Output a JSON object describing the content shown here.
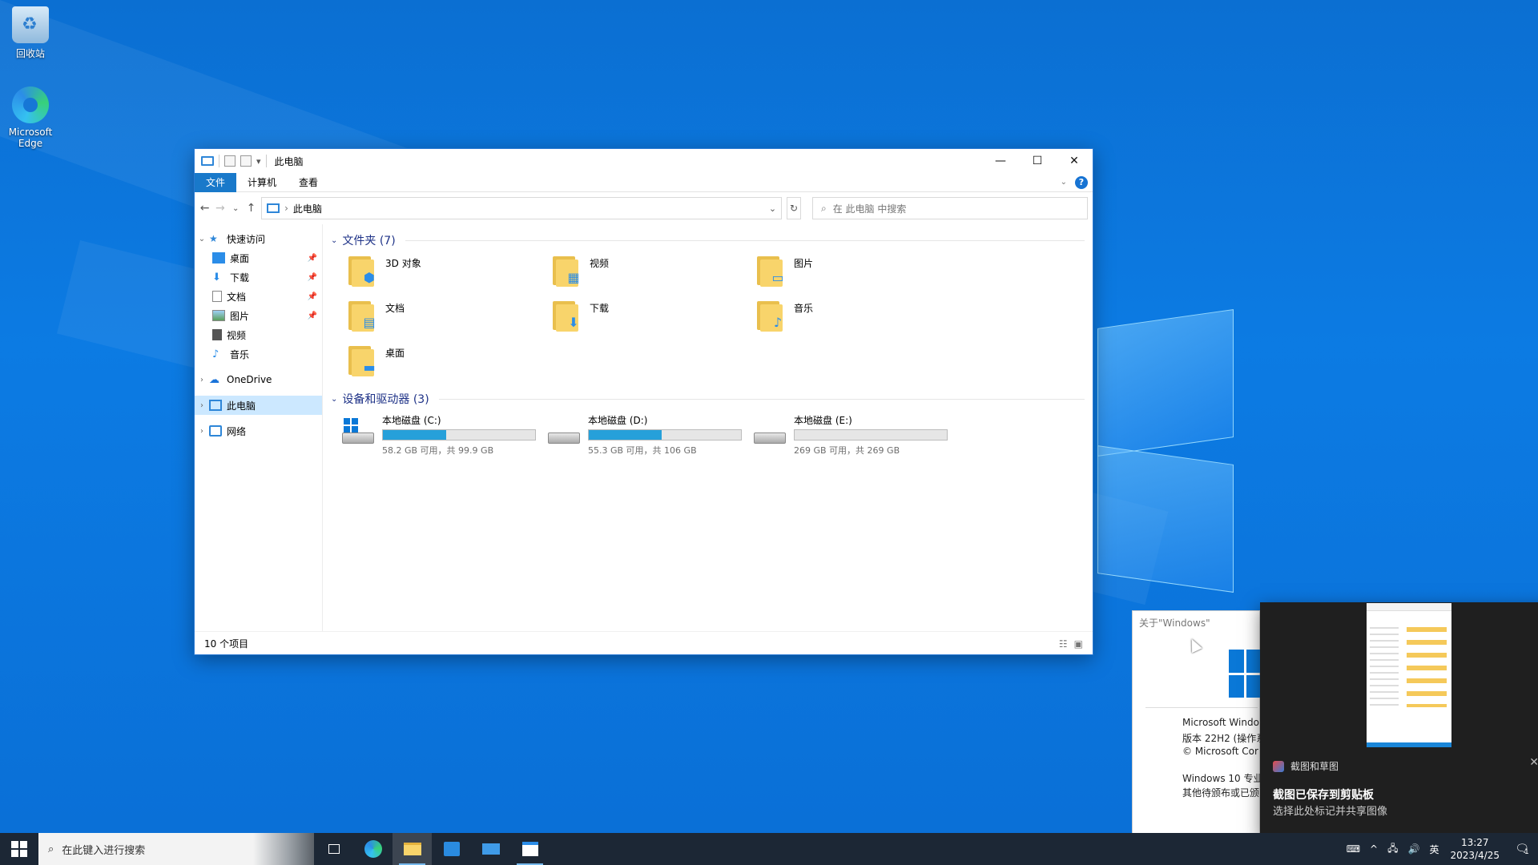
{
  "desktop": {
    "icons": [
      {
        "label": "回收站"
      },
      {
        "label": "Microsoft Edge"
      }
    ]
  },
  "explorer": {
    "title": "此电脑",
    "window_controls": {
      "minimize": "—",
      "maximize": "☐",
      "close": "✕"
    },
    "ribbon_tabs": [
      "文件",
      "计算机",
      "查看"
    ],
    "address": "此电脑",
    "search_placeholder": "在 此电脑 中搜索",
    "sidebar": {
      "quick_access": "快速访问",
      "quick_items": [
        {
          "label": "桌面",
          "pinned": true
        },
        {
          "label": "下载",
          "pinned": true
        },
        {
          "label": "文档",
          "pinned": true
        },
        {
          "label": "图片",
          "pinned": true
        },
        {
          "label": "视频",
          "pinned": false
        },
        {
          "label": "音乐",
          "pinned": false
        }
      ],
      "onedrive": "OneDrive",
      "this_pc": "此电脑",
      "network": "网络"
    },
    "folders_header": "文件夹 (7)",
    "folders": [
      {
        "name": "3D 对象",
        "emblem": "cube-icon"
      },
      {
        "name": "视频",
        "emblem": "film-icon"
      },
      {
        "name": "图片",
        "emblem": "picture-icon"
      },
      {
        "name": "文档",
        "emblem": "document-icon"
      },
      {
        "name": "下载",
        "emblem": "download-arrow-icon"
      },
      {
        "name": "音乐",
        "emblem": "music-note-icon"
      },
      {
        "name": "桌面",
        "emblem": "desktop-icon"
      }
    ],
    "drives_header": "设备和驱动器 (3)",
    "drives": [
      {
        "name": "本地磁盘 (C:)",
        "free": "58.2 GB 可用，共 99.9 GB",
        "used_fraction": 0.417,
        "system": true
      },
      {
        "name": "本地磁盘 (D:)",
        "free": "55.3 GB 可用，共 106 GB",
        "used_fraction": 0.478,
        "system": false
      },
      {
        "name": "本地磁盘 (E:)",
        "free": "269 GB 可用，共 269 GB",
        "used_fraction": 0.0,
        "system": false
      }
    ],
    "status": "10 个项目"
  },
  "about_window": {
    "title": "关于\"Windows\"",
    "lines": [
      "Microsoft Windo",
      "版本 22H2 (操作系",
      "© Microsoft Cor",
      "Windows 10 专业",
      "其他待颁布或已颁"
    ]
  },
  "toast": {
    "app_name": "截图和草图",
    "heading": "截图已保存到剪贴板",
    "body": "选择此处标记并共享图像"
  },
  "taskbar": {
    "search_placeholder": "在此键入进行搜索",
    "ime": "英",
    "time": "13:27",
    "date": "2023/4/25",
    "notification_count": "1"
  },
  "colors": {
    "accent": "#1979ca",
    "drive_fill": "#26a0da",
    "taskbar": "#1c2735",
    "selected": "#cce8ff"
  }
}
